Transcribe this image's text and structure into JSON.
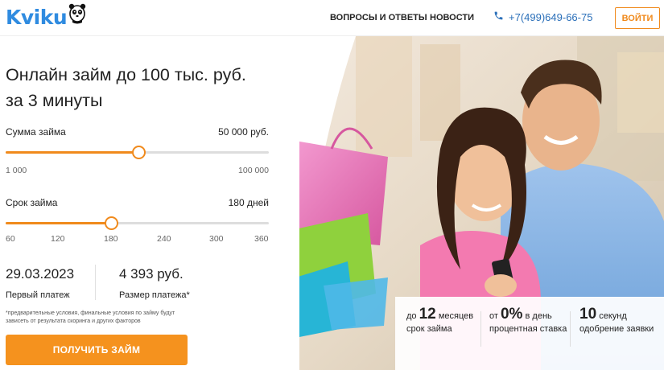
{
  "header": {
    "logo_text": "Kviku",
    "nav": {
      "faq": "ВОПРОСЫ И ОТВЕТЫ",
      "news": "НОВОСТИ"
    },
    "phone": "+7(499)649-66-75",
    "login": "ВОЙТИ"
  },
  "calculator": {
    "title_line1": "Онлайн займ до 100 тыс. руб.",
    "title_line2": "за 3 минуты",
    "amount": {
      "label": "Сумма займа",
      "value": "50 000 руб.",
      "min": "1 000",
      "max": "100 000",
      "position_pct": 50.5
    },
    "term": {
      "label": "Срок займа",
      "value": "180 дней",
      "ticks": [
        "60",
        "120",
        "180",
        "240",
        "300",
        "360"
      ],
      "position_pct": 40
    },
    "first_payment": {
      "value": "29.03.2023",
      "caption": "Первый платеж"
    },
    "payment_size": {
      "value": "4 393 руб.",
      "caption": "Размер платежа*"
    },
    "disclaimer": "*предварительные условия, финальные условия по займу будут зависеть от результата скоринга и других факторов",
    "cta": "ПОЛУЧИТЬ ЗАЙМ"
  },
  "benefits": [
    {
      "prefix": "до",
      "num": "12",
      "suffix": "месяцев",
      "caption": "срок займа"
    },
    {
      "prefix": "от",
      "num": "0%",
      "suffix": "в день",
      "caption": "процентная ставка"
    },
    {
      "prefix": "",
      "num": "10",
      "suffix": "секунд",
      "caption": "одобрение заявки"
    }
  ],
  "colors": {
    "accent": "#f5921e",
    "brand_blue": "#2f8be0",
    "phone_blue": "#2a6fb9"
  },
  "icons": {
    "logo_mascot": "panda-icon",
    "phone": "phone-icon"
  }
}
